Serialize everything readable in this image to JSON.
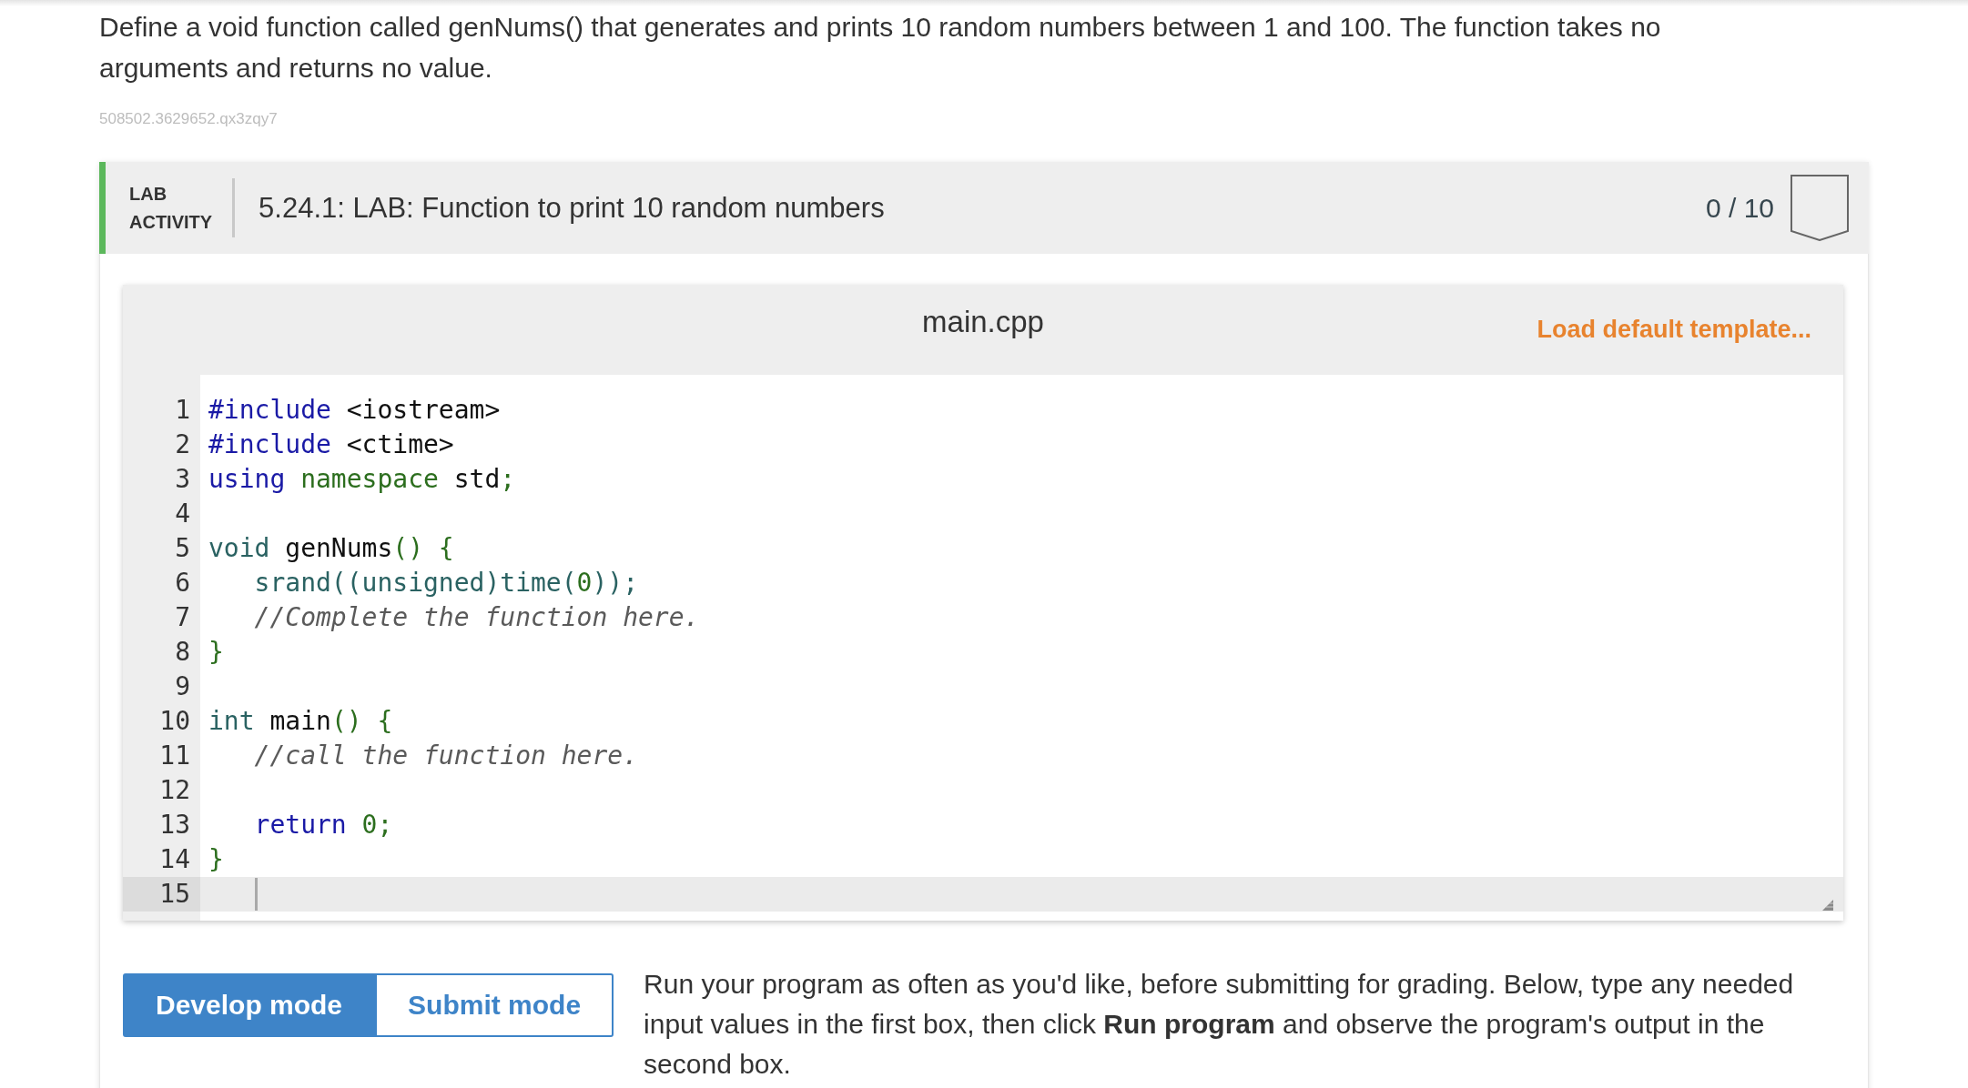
{
  "question": {
    "text": "Define a void function called genNums() that generates and prints 10 random numbers between 1 and 100. The function takes no arguments and returns no value.",
    "id": "508502.3629652.qx3zqy7"
  },
  "lab_activity": {
    "label": "LAB ACTIVITY",
    "title": "5.24.1: LAB: Function to print 10 random numbers",
    "score": "0 / 10"
  },
  "editor": {
    "filename": "main.cpp",
    "action": "Load default template...",
    "lines": [
      {
        "number": "1",
        "current": false,
        "tokens": [
          {
            "kind": "keyword",
            "text": "#include"
          },
          {
            "kind": "plain",
            "text": " <iostream>"
          }
        ]
      },
      {
        "number": "2",
        "current": false,
        "tokens": [
          {
            "kind": "keyword",
            "text": "#include"
          },
          {
            "kind": "plain",
            "text": " <ctime>"
          }
        ]
      },
      {
        "number": "3",
        "current": false,
        "tokens": [
          {
            "kind": "keyword",
            "text": "using"
          },
          {
            "kind": "storage",
            "text": " namespace"
          },
          {
            "kind": "plain",
            "text": " std"
          },
          {
            "kind": "punct",
            "text": ";"
          }
        ]
      },
      {
        "number": "4",
        "current": false
      },
      {
        "number": "5",
        "current": false,
        "tokens": [
          {
            "kind": "type",
            "text": "void"
          },
          {
            "kind": "plain",
            "text": " genNums"
          },
          {
            "kind": "punct",
            "text": "() {"
          }
        ],
        "children": [
          {
            "number": "6",
            "current": false,
            "tokens": [
              {
                "kind": "type",
                "text": "srand((unsigned)time("
              },
              {
                "kind": "number",
                "text": "0"
              },
              {
                "kind": "type",
                "text": "));"
              }
            ]
          },
          {
            "number": "7",
            "current": false,
            "tokens": [
              {
                "kind": "comment",
                "text": "//Complete the function here."
              }
            ]
          }
        ]
      },
      {
        "number": "8",
        "current": false,
        "tokens": [
          {
            "kind": "punct",
            "text": "}"
          }
        ]
      },
      {
        "number": "9",
        "current": false
      },
      {
        "number": "10",
        "current": false,
        "tokens": [
          {
            "kind": "type",
            "text": "int"
          },
          {
            "kind": "plain",
            "text": " main"
          },
          {
            "kind": "punct",
            "text": "() {"
          }
        ],
        "children": [
          {
            "number": "11",
            "current": false,
            "tokens": [
              {
                "kind": "comment",
                "text": "//call the function here."
              }
            ]
          },
          {
            "number": "12",
            "current": false
          },
          {
            "number": "13",
            "current": false,
            "tokens": [
              {
                "kind": "keyword",
                "text": "return"
              },
              {
                "kind": "number",
                "text": " 0"
              },
              {
                "kind": "punct",
                "text": ";"
              }
            ]
          }
        ]
      },
      {
        "number": "14",
        "current": false,
        "tokens": [
          {
            "kind": "punct",
            "text": "}"
          }
        ]
      },
      {
        "number": "15",
        "current": true
      }
    ]
  },
  "modes": [
    {
      "label": "Develop mode",
      "selected": true
    },
    {
      "label": "Submit mode",
      "selected": false
    }
  ],
  "instructions": "Run your program as often as you'd like, before submitting for grading. Below, type any needed input values in the first box, then click **Run program** and observe the program's output in the second box."
}
